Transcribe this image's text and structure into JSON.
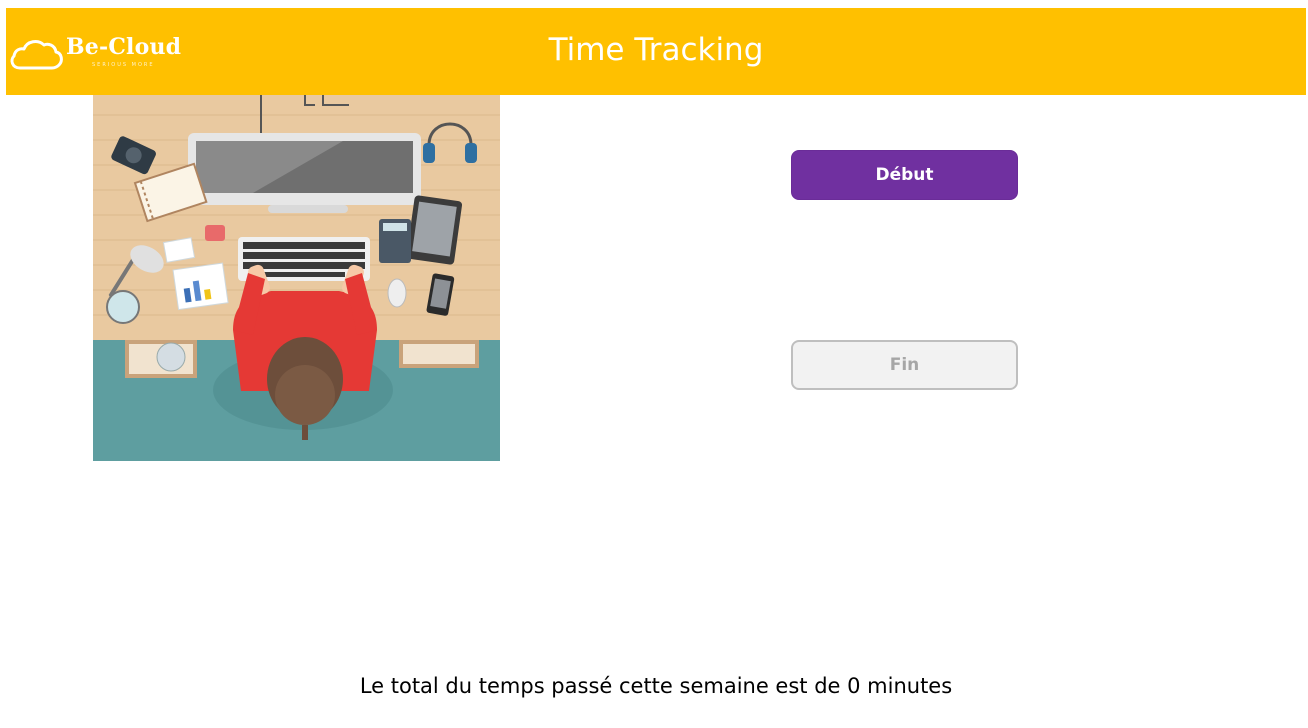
{
  "header": {
    "logo_text": "Be-Cloud",
    "logo_tagline": "SERIOUS MORE",
    "title": "Time Tracking"
  },
  "actions": {
    "start_label": "Début",
    "end_label": "Fin"
  },
  "summary": {
    "total_text": "Le total du temps passé cette semaine est de 0 minutes"
  },
  "colors": {
    "header": "#ffc000",
    "start_button": "#7030a0",
    "end_button_bg": "#f2f2f2",
    "end_button_text": "#a6a6a6"
  },
  "icons": {
    "logo": "cloud-icon",
    "illustration": "workspace-desk-illustration"
  }
}
